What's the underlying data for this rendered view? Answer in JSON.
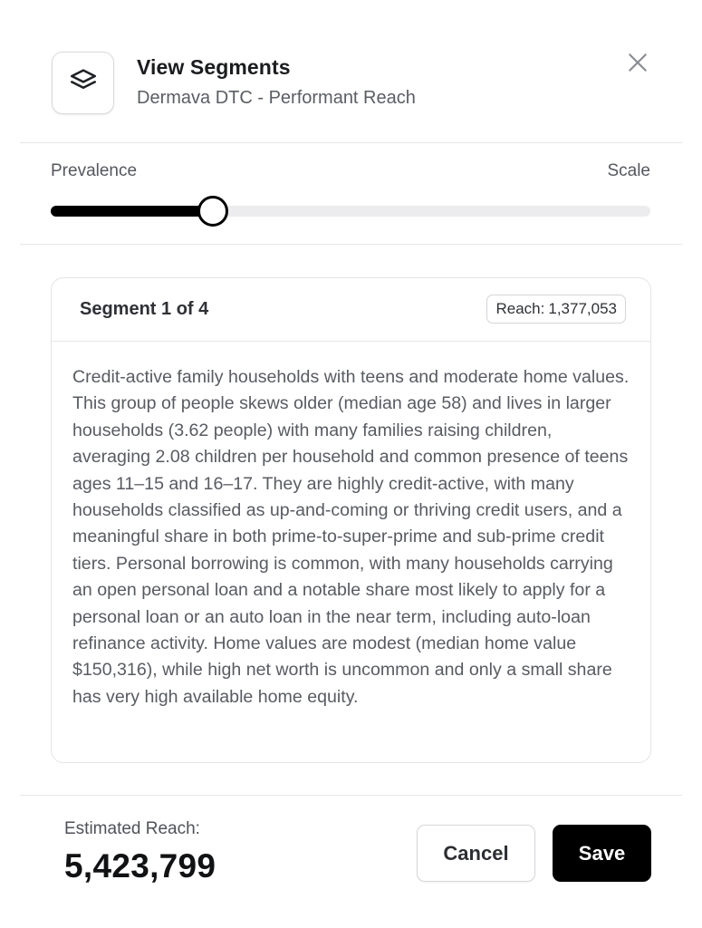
{
  "header": {
    "title": "View Segments",
    "subtitle": "Dermava DTC - Performant Reach",
    "icon": "layers-icon",
    "close_icon": "close-icon"
  },
  "slider": {
    "left_label": "Prevalence",
    "right_label": "Scale",
    "value_fraction": 0.27
  },
  "segment": {
    "label": "Segment 1 of 4",
    "reach_label": "Reach:",
    "reach_value": "1,377,053",
    "description": "Credit-active family households with teens and moderate home values. This group of people skews older (median age 58) and lives in larger households (3.62 people) with many families raising children, averaging 2.08 children per household and common presence of teens ages 11–15 and 16–17. They are highly credit-active, with many households classified as up-and-coming or thriving credit users, and a meaningful share in both prime-to-super-prime and sub-prime credit tiers. Personal borrowing is common, with many households carrying an open personal loan and a notable share most likely to apply for a personal loan or an auto loan in the near term, including auto-loan refinance activity. Home values are modest (median home value $150,316), while high net worth is uncommon and only a small share has very high available home equity."
  },
  "footer": {
    "estimated_label": "Estimated Reach:",
    "estimated_value": "5,423,799",
    "cancel_label": "Cancel",
    "save_label": "Save"
  },
  "colors": {
    "accent": "#000000",
    "muted_text": "#585b62",
    "border": "#e3e4e7"
  }
}
